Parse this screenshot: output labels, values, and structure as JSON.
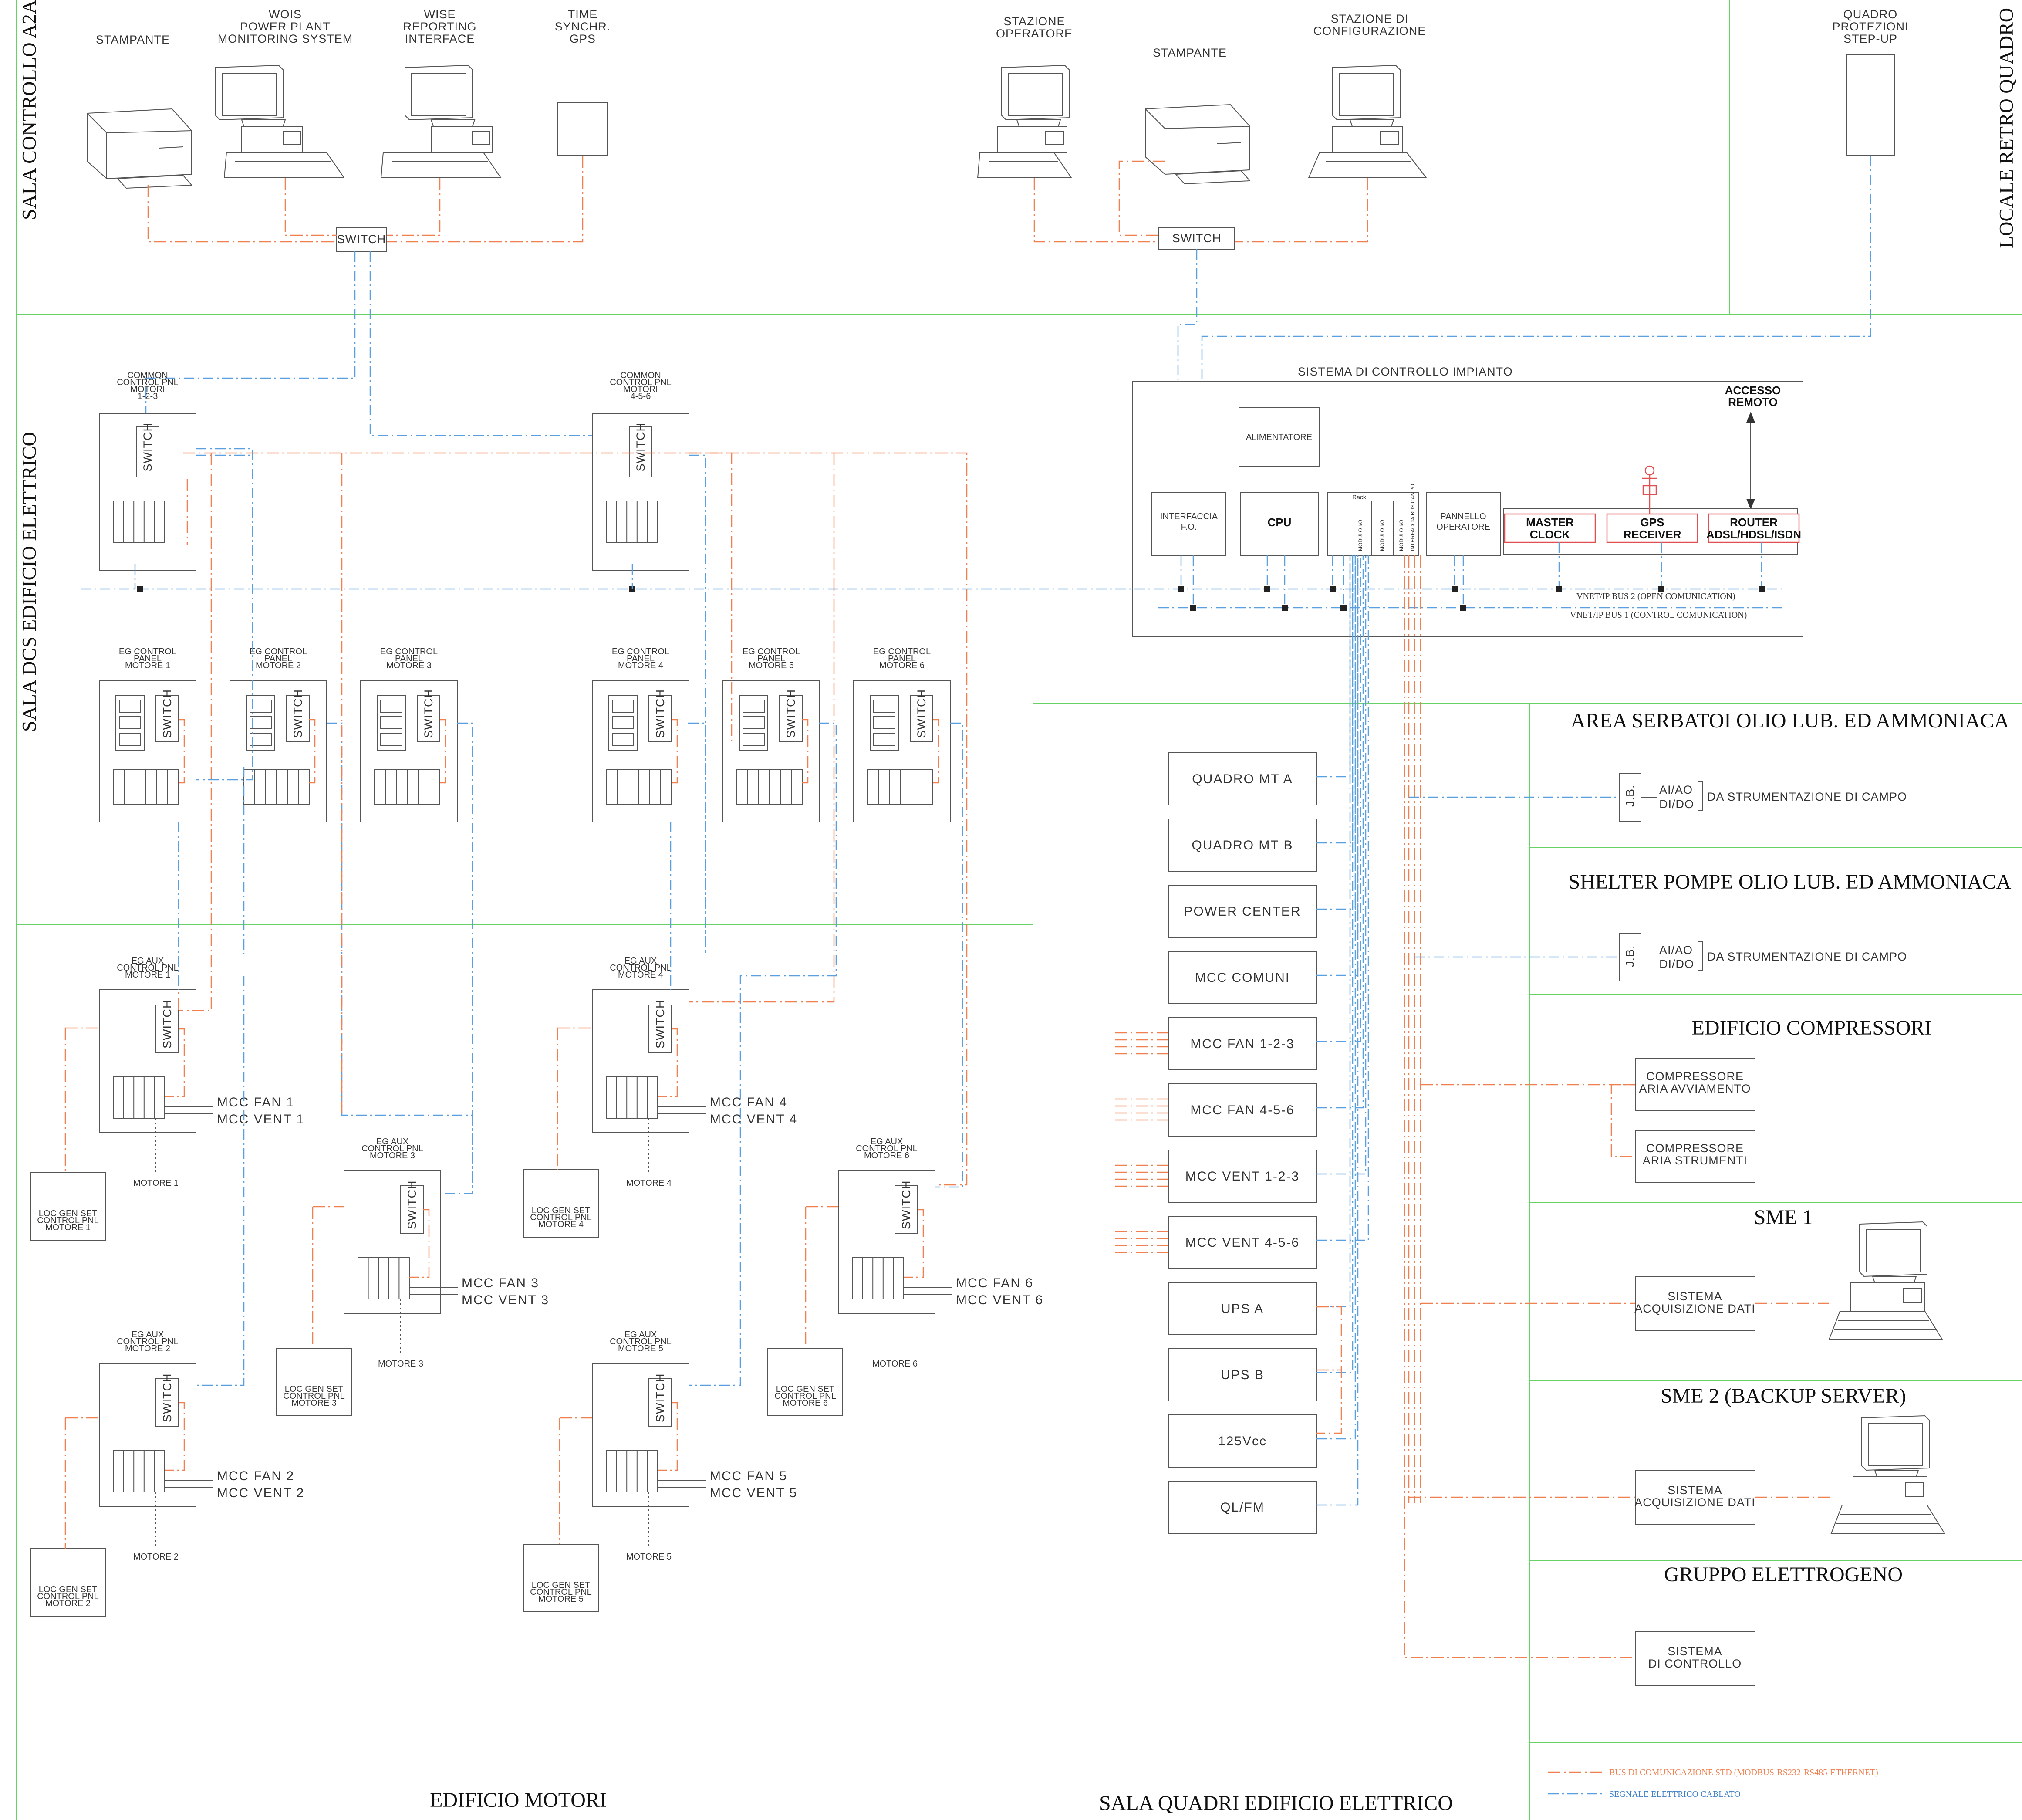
{
  "zones": {
    "sala_controllo": "SALA CONTROLLO A2A",
    "locale_retro": "LOCALE RETRO QUADRO",
    "sala_dcs": "SALA DCS EDIFICIO ELETTRICO",
    "edificio_motori": "EDIFICIO MOTORI",
    "sala_quadri": "SALA QUADRI EDIFICIO ELETTRICO",
    "area_serbatoi": "AREA SERBATOI OLIO LUB. ED AMMONIACA",
    "shelter_pompe": "SHELTER POMPE OLIO LUB. ED AMMONIACA",
    "edificio_compressori": "EDIFICIO COMPRESSORI",
    "sme1": "SME 1",
    "sme2": "SME 2 (BACKUP SERVER)",
    "gruppo_elettrogeno": "GRUPPO ELETTROGENO"
  },
  "control_room": {
    "stampante1": "STAMPANTE",
    "wois": [
      "WOIS",
      "POWER PLANT",
      "MONITORING SYSTEM"
    ],
    "wise": [
      "WISE",
      "REPORTING",
      "INTERFACE"
    ],
    "time": [
      "TIME",
      "SYNCHR.",
      "GPS"
    ],
    "stazione_op": [
      "STAZIONE",
      "OPERATORE"
    ],
    "stampante2": "STAMPANTE",
    "stazione_conf": [
      "STAZIONE DI",
      "CONFIGURAZIONE"
    ],
    "quadro": [
      "QUADRO",
      "PROTEZIONI",
      "STEP-UP"
    ],
    "switch": "SWITCH"
  },
  "dcs": {
    "title": "SISTEMA DI CONTROLLO IMPIANTO",
    "accesso": [
      "ACCESSO",
      "REMOTO"
    ],
    "alimentatore": "ALIMENTATORE",
    "interfaccia": [
      "INTERFACCIA",
      "F.O."
    ],
    "cpu": "CPU",
    "rack": "Rack",
    "moduli": [
      "MODULO I/O",
      "MODULO I/O",
      "MODULO I/O",
      "INTERFACCIA BUS CAMPO"
    ],
    "pannello": [
      "PANNELLO",
      "OPERATORE"
    ],
    "master": [
      "MASTER",
      "CLOCK"
    ],
    "gps": [
      "GPS",
      "RECEIVER"
    ],
    "router": [
      "ROUTER",
      "ADSL/HDSL/ISDN"
    ],
    "bus2": "VNET/IP BUS 2   (OPEN COMUNICATION)",
    "bus1": "VNET/IP BUS 1  (CONTROL COMUNICATION)"
  },
  "panels": {
    "common123": [
      "COMMON",
      "CONTROL PNL",
      "MOTORI",
      "1-2-3"
    ],
    "common456": [
      "COMMON",
      "CONTROL PNL",
      "MOTORI",
      "4-5-6"
    ],
    "eg_control": [
      [
        "EG CONTROL",
        "PANEL",
        "MOTORE 1"
      ],
      [
        "EG CONTROL",
        "PANEL",
        "MOTORE 2"
      ],
      [
        "EG CONTROL",
        "PANEL",
        "MOTORE 3"
      ],
      [
        "EG CONTROL",
        "PANEL",
        "MOTORE 4"
      ],
      [
        "EG CONTROL",
        "PANEL",
        "MOTORE 5"
      ],
      [
        "EG CONTROL",
        "PANEL",
        "MOTORE 6"
      ]
    ],
    "eg_aux": [
      [
        "EG AUX",
        "CONTROL PNL",
        "MOTORE 1"
      ],
      [
        "EG AUX",
        "CONTROL PNL",
        "MOTORE 2"
      ],
      [
        "EG AUX",
        "CONTROL PNL",
        "MOTORE 3"
      ],
      [
        "EG AUX",
        "CONTROL PNL",
        "MOTORE 4"
      ],
      [
        "EG AUX",
        "CONTROL PNL",
        "MOTORE 5"
      ],
      [
        "EG AUX",
        "CONTROL PNL",
        "MOTORE 6"
      ]
    ],
    "loc_gen": [
      [
        "LOC GEN SET",
        "CONTROL PNL",
        "MOTORE 1"
      ],
      [
        "LOC GEN SET",
        "CONTROL PNL",
        "MOTORE 2"
      ],
      [
        "LOC GEN SET",
        "CONTROL PNL",
        "MOTORE 3"
      ],
      [
        "LOC GEN SET",
        "CONTROL PNL",
        "MOTORE 4"
      ],
      [
        "LOC GEN SET",
        "CONTROL PNL",
        "MOTORE 5"
      ],
      [
        "LOC GEN SET",
        "CONTROL PNL",
        "MOTORE 6"
      ]
    ],
    "motore": [
      "MOTORE 1",
      "MOTORE 2",
      "MOTORE 3",
      "MOTORE 4",
      "MOTORE 5",
      "MOTORE 6"
    ],
    "mcc_fan": [
      "MCC FAN 1",
      "MCC FAN 2",
      "MCC FAN 3",
      "MCC FAN 4",
      "MCC FAN 5",
      "MCC FAN 6"
    ],
    "mcc_vent": [
      "MCC VENT 1",
      "MCC VENT 2",
      "MCC VENT 3",
      "MCC VENT 4",
      "MCC VENT 5",
      "MCC VENT 6"
    ]
  },
  "quadri": [
    "QUADRO MT A",
    "QUADRO MT B",
    "POWER CENTER",
    "MCC COMUNI",
    "MCC FAN 1-2-3",
    "MCC FAN 4-5-6",
    "MCC VENT 1-2-3",
    "MCC VENT 4-5-6",
    "UPS A",
    "UPS B",
    "125Vcc",
    "QL/FM"
  ],
  "field": {
    "jb": "J.B.",
    "aiao": "AI/AO",
    "dido": "DI/DO",
    "strumentazione": "DA STRUMENTAZIONE DI CAMPO",
    "comp_avv": [
      "COMPRESSORE",
      "ARIA AVVIAMENTO"
    ],
    "comp_str": [
      "COMPRESSORE",
      "ARIA STRUMENTI"
    ],
    "sistema_acq": [
      "SISTEMA",
      "ACQUISIZIONE DATI"
    ],
    "sistema_ctrl": [
      "SISTEMA",
      "DI CONTROLLO"
    ]
  },
  "legend": {
    "bus": "BUS DI COMUNICAZIONE STD (MODBUS-RS232-RS485-ETHERNET)",
    "segnale": "SEGNALE ELETTRICO CABLATO",
    "bus_color": "#f08050",
    "segnale_color": "#5aa0e0"
  }
}
